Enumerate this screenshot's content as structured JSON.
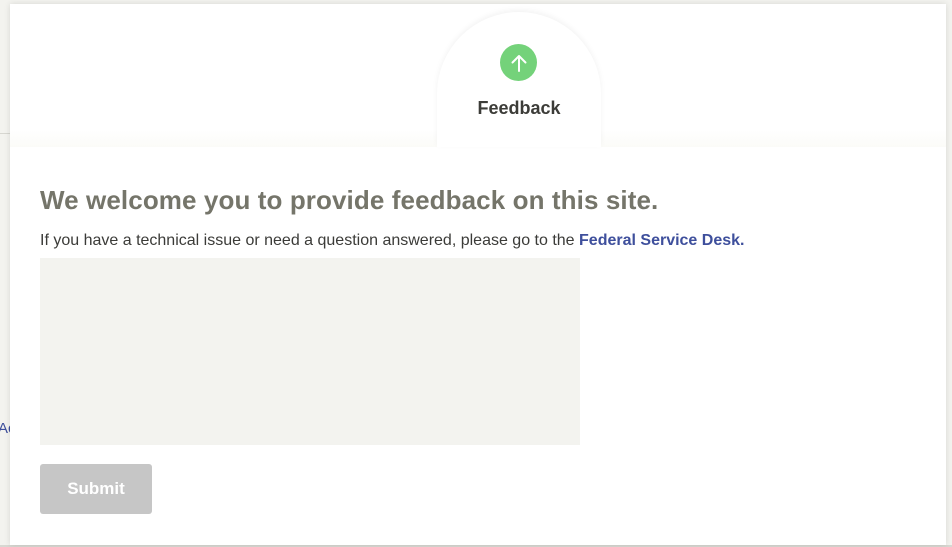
{
  "background": {
    "partial_link_text": "Ac"
  },
  "feedback_tab": {
    "label": "Feedback",
    "icon": "arrow-up-icon",
    "icon_color": "#74d27a"
  },
  "form": {
    "heading": "We welcome you to provide feedback on this site.",
    "description_prefix": "If you have a technical issue or need a question answered, please go to the ",
    "service_desk_link": "Federal Service Desk.",
    "textarea_value": "",
    "submit_label": "Submit"
  },
  "colors": {
    "link": "#3e4f9c",
    "heading": "#75756a",
    "submit_disabled": "#c6c6c6",
    "textarea_bg": "#f3f3ef"
  }
}
